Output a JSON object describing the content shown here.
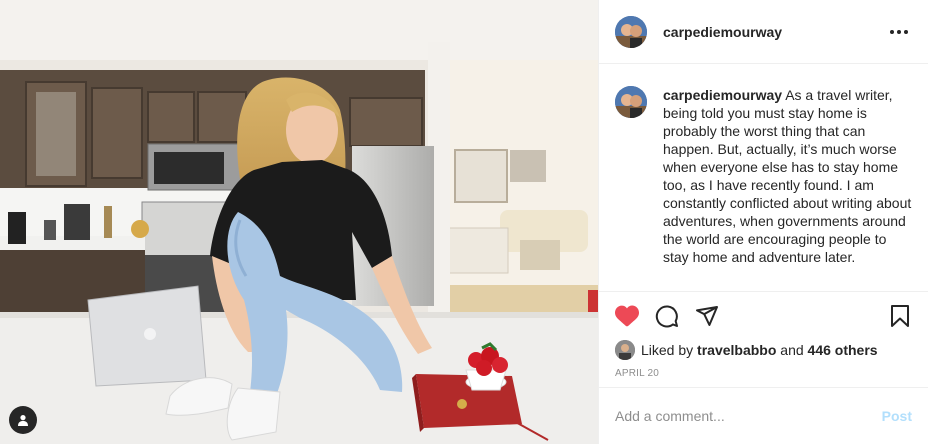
{
  "post": {
    "username": "carpediemourway",
    "caption": "As a travel writer, being told you must stay home is probably the worst thing that can happen. But, actually, it’s much worse when everyone else has to stay home too, as I have recently found. I am constantly conflicted about writing about adventures, when governments around the world are encouraging people to stay home and adventure later.",
    "liked_by_prefix": "Liked by",
    "liked_by_user": "travelbabbo",
    "liked_by_and": "and",
    "liked_by_others": "446 others",
    "date": "April 20"
  },
  "comment": {
    "placeholder": "Add a comment...",
    "post_label": "Post"
  },
  "colors": {
    "like_red": "#ed4956",
    "post_button_disabled": "#b2dffc",
    "muted_text": "#8e8e8e"
  },
  "icons": [
    "heart-icon",
    "comment-icon",
    "share-icon",
    "bookmark-icon",
    "more-icon",
    "user-tag-icon"
  ]
}
